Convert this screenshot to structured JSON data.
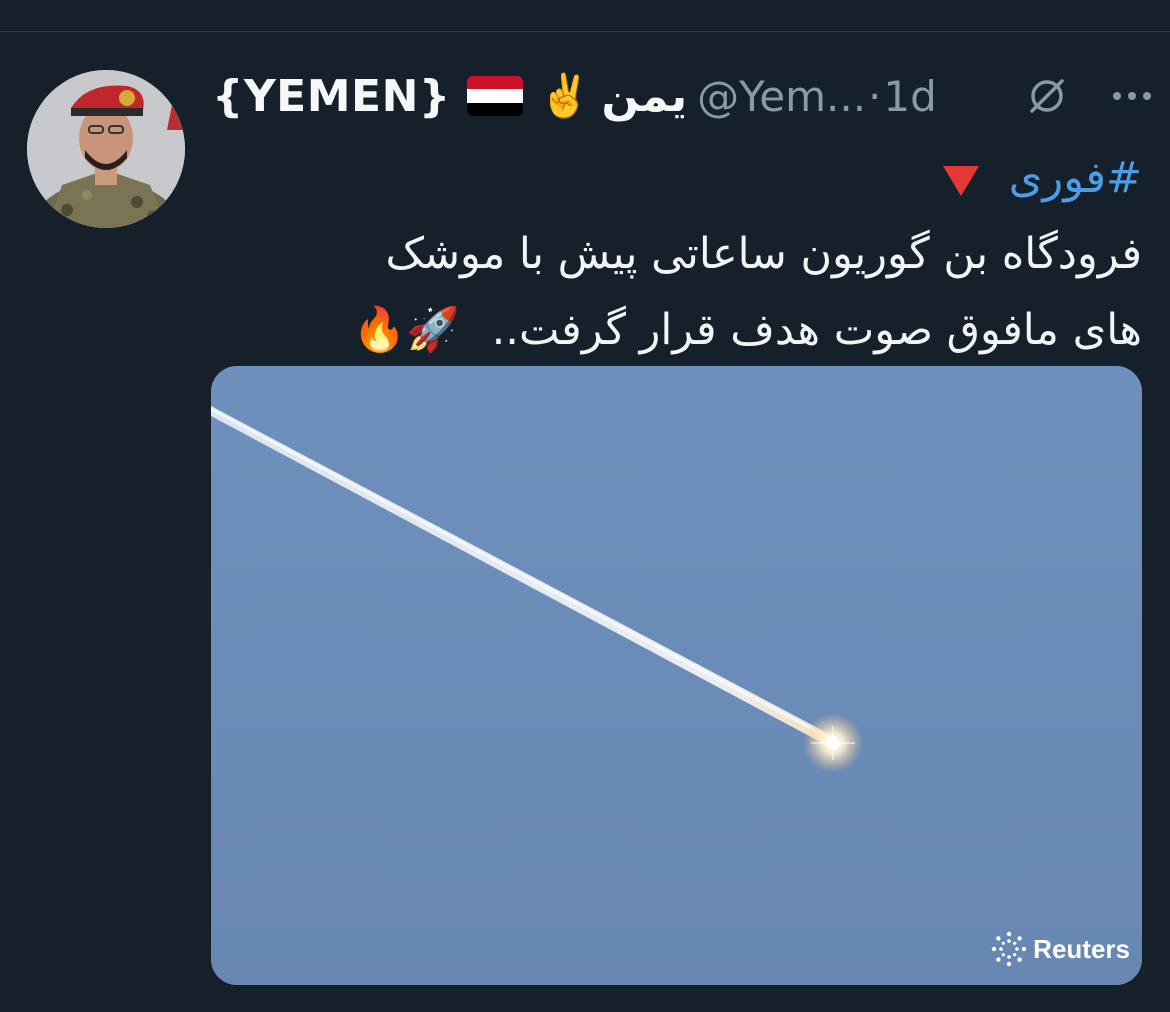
{
  "tweet": {
    "display_name": "{YEMEN}",
    "name_arabic": "يمن",
    "handle": "@Yem...",
    "separator": "·",
    "time": "1d",
    "hashtag": "#فوری",
    "line1": "فرودگاه بن گوریون ساعاتی پیش با موشک",
    "line2": "های مافوق صوت هدف قرار گرفت..",
    "line2_emoji": "🚀🔥",
    "peace_emoji": "✌️",
    "media_credit": "Reuters"
  },
  "colors": {
    "background": "#15202b",
    "hashtag": "#4a9fe8",
    "secondary_text": "#8b98a5",
    "sky": "#6c8db8",
    "alert_triangle": "#e53935"
  },
  "icons": [
    "flag-yemen-icon",
    "peace-hand-icon",
    "grok-slash-icon",
    "more-dots-icon",
    "red-triangle-icon",
    "rocket-icon",
    "fire-icon",
    "reuters-logo-icon"
  ]
}
